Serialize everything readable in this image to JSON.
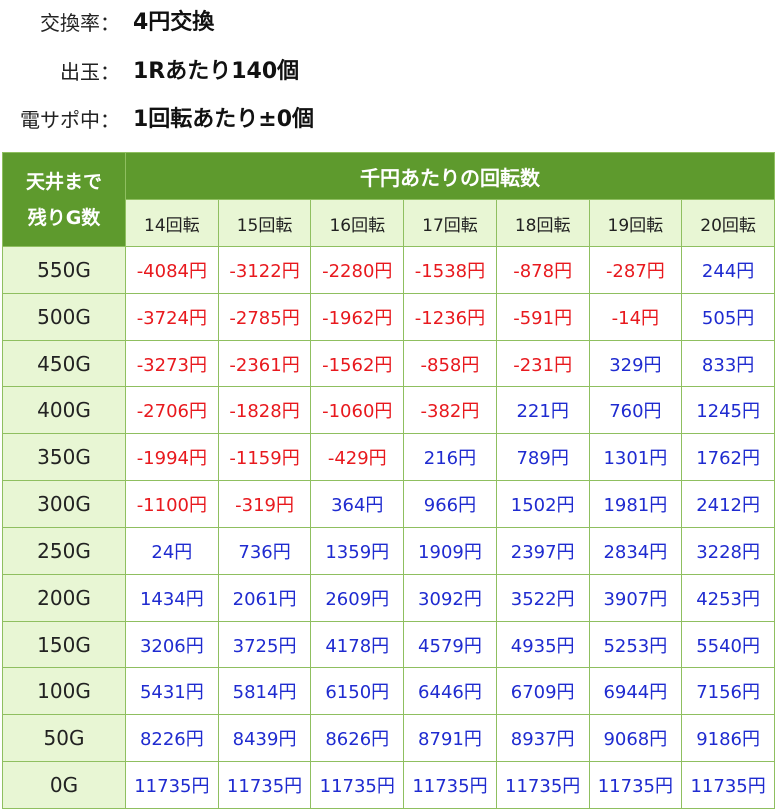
{
  "info": [
    {
      "label": "交換率：",
      "value": "4円交換"
    },
    {
      "label": "出玉：",
      "value": "1Rあたり140個"
    },
    {
      "label": "電サポ中：",
      "value": "1回転あたり±0個"
    }
  ],
  "table": {
    "corner_label": "天井まで\n残りG数",
    "top_header": "千円あたりの回転数",
    "columns": [
      "14回転",
      "15回転",
      "16回転",
      "17回転",
      "18回転",
      "19回転",
      "20回転"
    ],
    "rows": [
      {
        "label": "550G",
        "values": [
          "-4084円",
          "-3122円",
          "-2280円",
          "-1538円",
          "-878円",
          "-287円",
          "244円"
        ]
      },
      {
        "label": "500G",
        "values": [
          "-3724円",
          "-2785円",
          "-1962円",
          "-1236円",
          "-591円",
          "-14円",
          "505円"
        ]
      },
      {
        "label": "450G",
        "values": [
          "-3273円",
          "-2361円",
          "-1562円",
          "-858円",
          "-231円",
          "329円",
          "833円"
        ]
      },
      {
        "label": "400G",
        "values": [
          "-2706円",
          "-1828円",
          "-1060円",
          "-382円",
          "221円",
          "760円",
          "1245円"
        ]
      },
      {
        "label": "350G",
        "values": [
          "-1994円",
          "-1159円",
          "-429円",
          "216円",
          "789円",
          "1301円",
          "1762円"
        ]
      },
      {
        "label": "300G",
        "values": [
          "-1100円",
          "-319円",
          "364円",
          "966円",
          "1502円",
          "1981円",
          "2412円"
        ]
      },
      {
        "label": "250G",
        "values": [
          "24円",
          "736円",
          "1359円",
          "1909円",
          "2397円",
          "2834円",
          "3228円"
        ]
      },
      {
        "label": "200G",
        "values": [
          "1434円",
          "2061円",
          "2609円",
          "3092円",
          "3522円",
          "3907円",
          "4253円"
        ]
      },
      {
        "label": "150G",
        "values": [
          "3206円",
          "3725円",
          "4178円",
          "4579円",
          "4935円",
          "5253円",
          "5540円"
        ]
      },
      {
        "label": "100G",
        "values": [
          "5431円",
          "5814円",
          "6150円",
          "6446円",
          "6709円",
          "6944円",
          "7156円"
        ]
      },
      {
        "label": "50G",
        "values": [
          "8226円",
          "8439円",
          "8626円",
          "8791円",
          "8937円",
          "9068円",
          "9186円"
        ]
      },
      {
        "label": "0G",
        "values": [
          "11735円",
          "11735円",
          "11735円",
          "11735円",
          "11735円",
          "11735円",
          "11735円"
        ]
      }
    ]
  },
  "colors": {
    "header_green": "#5e9a2d",
    "header_light": "#e8f6d4",
    "negative": "#e8191e",
    "positive": "#1f2bd0"
  }
}
